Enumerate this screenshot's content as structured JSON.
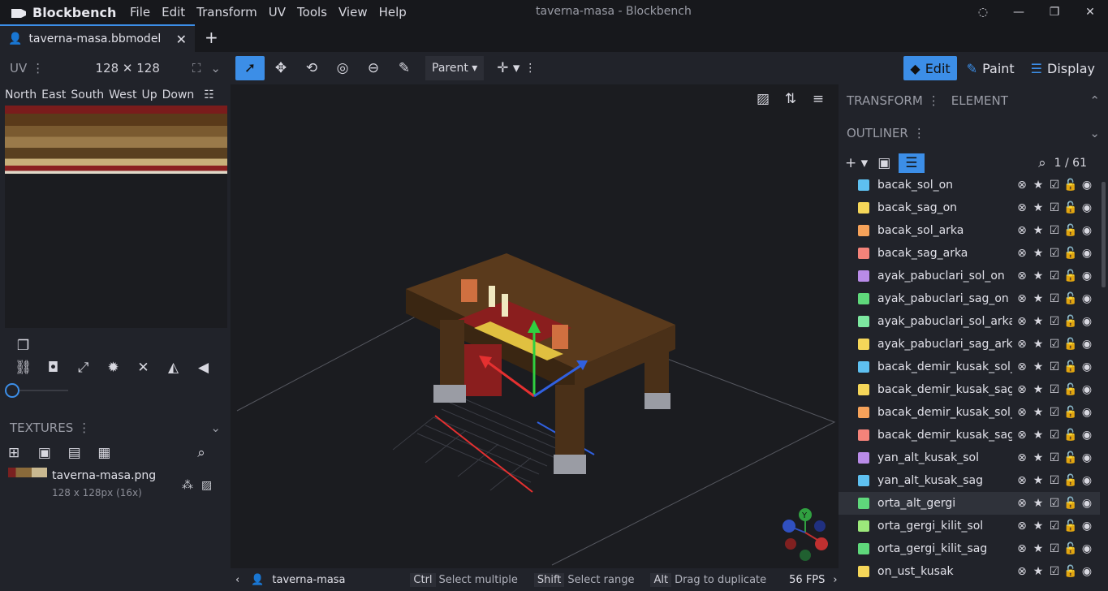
{
  "app": {
    "name": "Blockbench",
    "window_title": "taverna-masa - Blockbench"
  },
  "menu": [
    "File",
    "Edit",
    "Transform",
    "UV",
    "Tools",
    "View",
    "Help"
  ],
  "tab": {
    "label": "taverna-masa.bbmodel"
  },
  "uv": {
    "title": "UV",
    "size": "128 ✕ 128",
    "faces": [
      "North",
      "East",
      "South",
      "West",
      "Up",
      "Down"
    ]
  },
  "textures": {
    "title": "TEXTURES",
    "item_name": "taverna-masa.png",
    "item_info": "128 x 128px (16x)"
  },
  "toolbar": {
    "pivot_label": "Parent"
  },
  "modes": {
    "edit": "Edit",
    "paint": "Paint",
    "display": "Display"
  },
  "panels": {
    "transform": "TRANSFORM",
    "element": "ELEMENT",
    "outliner": "OUTLINER",
    "count": "1 / 61"
  },
  "outliner": [
    {
      "name": "bacak_sol_on",
      "color": "#5ec0f0"
    },
    {
      "name": "bacak_sag_on",
      "color": "#f5d659"
    },
    {
      "name": "bacak_sol_arka",
      "color": "#f6a25a"
    },
    {
      "name": "bacak_sag_arka",
      "color": "#f4837a"
    },
    {
      "name": "ayak_pabuclari_sol_on",
      "color": "#b98be8"
    },
    {
      "name": "ayak_pabuclari_sag_on",
      "color": "#5fd87b"
    },
    {
      "name": "ayak_pabuclari_sol_arka",
      "color": "#7de8a0"
    },
    {
      "name": "ayak_pabuclari_sag_arka",
      "color": "#f5d659"
    },
    {
      "name": "bacak_demir_kusak_sol_",
      "color": "#5ec0f0"
    },
    {
      "name": "bacak_demir_kusak_sag",
      "color": "#f5d659"
    },
    {
      "name": "bacak_demir_kusak_sol_",
      "color": "#f6a25a"
    },
    {
      "name": "bacak_demir_kusak_sag",
      "color": "#f4837a"
    },
    {
      "name": "yan_alt_kusak_sol",
      "color": "#b98be8"
    },
    {
      "name": "yan_alt_kusak_sag",
      "color": "#5ec0f0"
    },
    {
      "name": "orta_alt_gergi",
      "color": "#5fd87b"
    },
    {
      "name": "orta_gergi_kilit_sol",
      "color": "#9ce87b"
    },
    {
      "name": "orta_gergi_kilit_sag",
      "color": "#5fd87b"
    },
    {
      "name": "on_ust_kusak",
      "color": "#f5d659"
    }
  ],
  "status": {
    "model": "taverna-masa",
    "ctrl": "Ctrl",
    "ctrl_hint": "Select multiple",
    "shift": "Shift",
    "shift_hint": "Select range",
    "alt": "Alt",
    "alt_hint": "Drag to duplicate",
    "fps": "56 FPS"
  },
  "gizmo": {
    "y": "Y"
  }
}
